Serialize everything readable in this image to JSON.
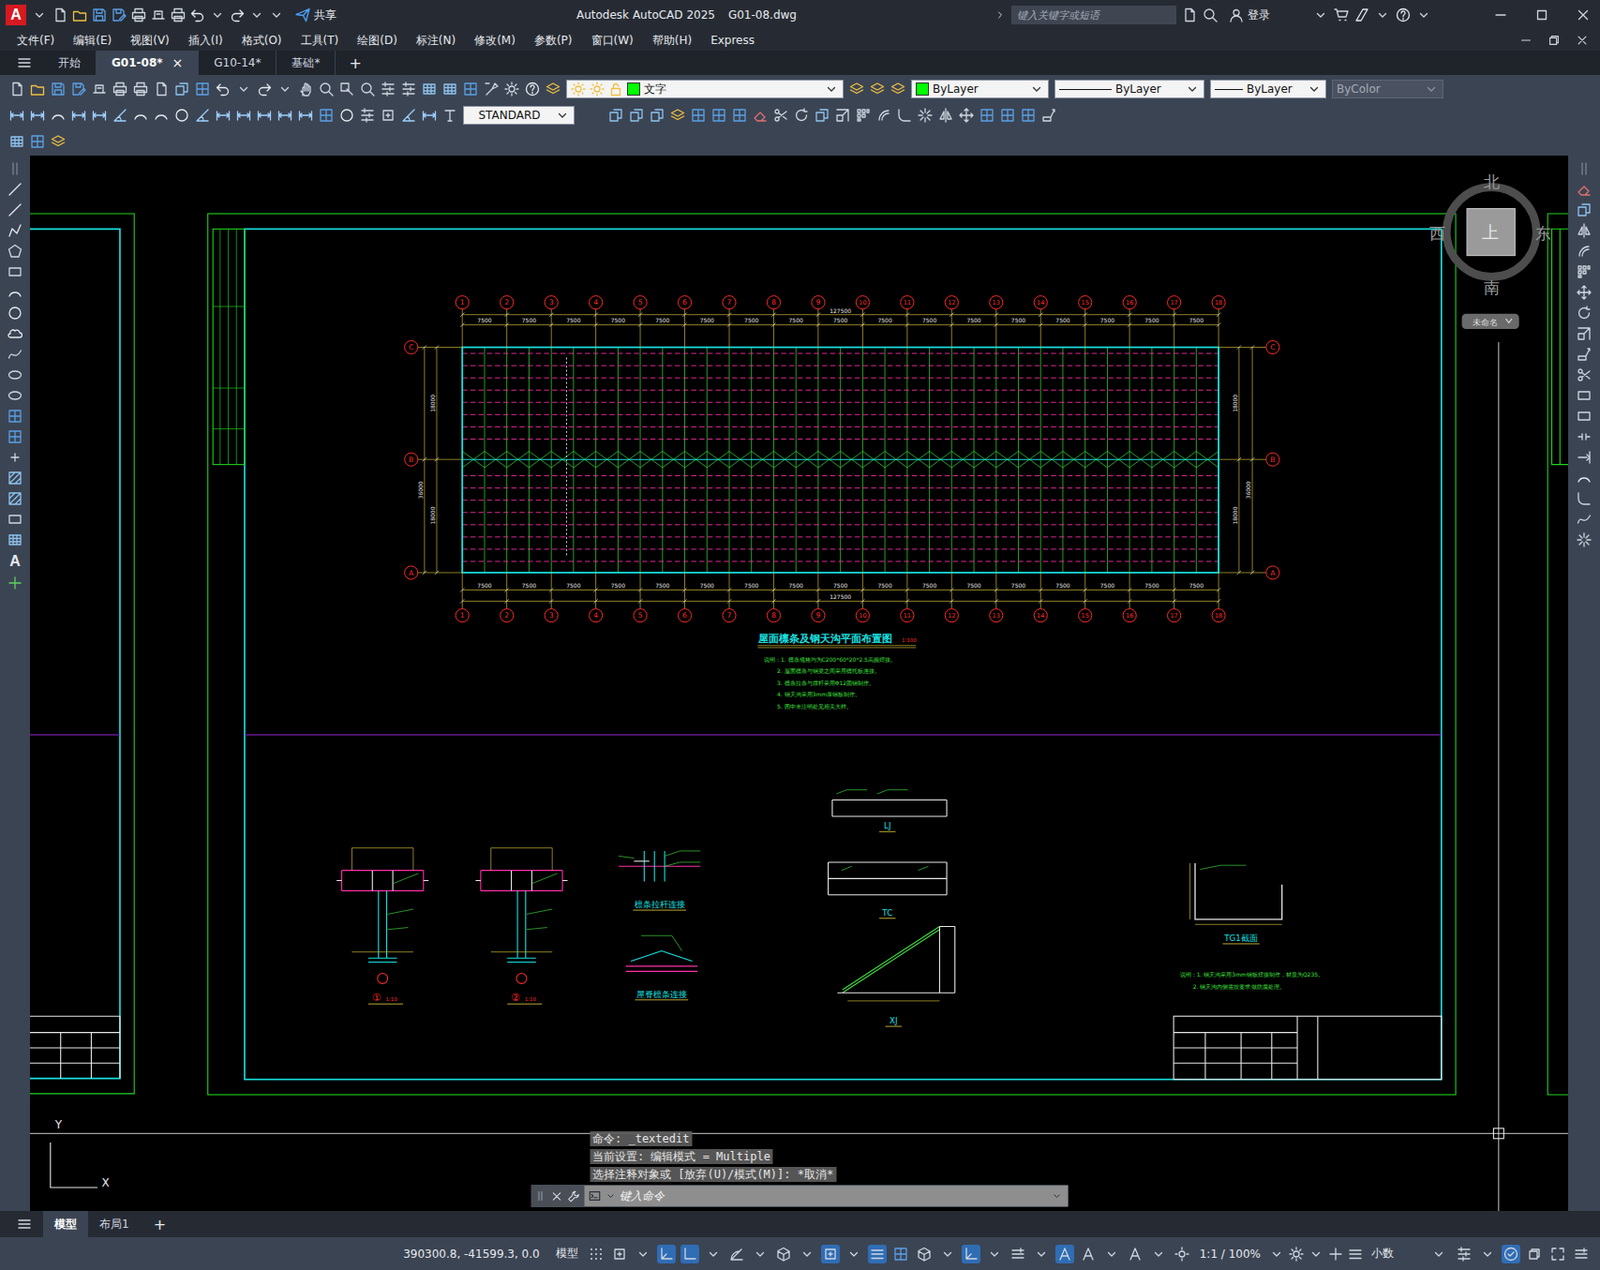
{
  "window": {
    "logo": "A",
    "share": "共享",
    "title": "Autodesk AutoCAD 2025",
    "file": "G01-08.dwg",
    "search_placeholder": "键入关键字或短语",
    "sign_in": "登录"
  },
  "menu": [
    "文件(F)",
    "编辑(E)",
    "视图(V)",
    "插入(I)",
    "格式(O)",
    "工具(T)",
    "绘图(D)",
    "标注(N)",
    "修改(M)",
    "参数(P)",
    "窗口(W)",
    "帮助(H)",
    "Express"
  ],
  "doc_tabs": {
    "items": [
      {
        "label": "开始",
        "selected": false
      },
      {
        "label": "G01-08*",
        "selected": true
      },
      {
        "label": "G10-14*",
        "selected": false
      },
      {
        "label": "基础*",
        "selected": false
      }
    ],
    "close": "×",
    "add": "+"
  },
  "toolbar": {
    "layer": {
      "value": "文字",
      "color": "#00ff00"
    },
    "color": {
      "value": "ByLayer",
      "color": "#00ff00"
    },
    "linetype": "ByLayer",
    "lineweight": "ByLayer",
    "plotstyle": {
      "value": "ByColor",
      "disabled": true
    },
    "text_style": "STANDARD"
  },
  "palettes": {
    "text_tool": "A"
  },
  "drawing": {
    "columns": [
      "1",
      "2",
      "3",
      "4",
      "5",
      "6",
      "7",
      "8",
      "9",
      "10",
      "11",
      "12",
      "13",
      "14",
      "15",
      "16",
      "17",
      "18"
    ],
    "rows": [
      "C",
      "B",
      "A"
    ],
    "bays_top": [
      "7500",
      "7500",
      "7500",
      "7500",
      "7500",
      "7500",
      "7500",
      "7500",
      "7500",
      "7500",
      "7500",
      "7500",
      "7500",
      "7500",
      "7500",
      "7500",
      "7500"
    ],
    "bays_bottom": [
      "7500",
      "7500",
      "7500",
      "7500",
      "7500",
      "7500",
      "7500",
      "7500",
      "7500",
      "7500",
      "7500",
      "7500",
      "7500",
      "7500",
      "7500",
      "7500",
      "7500"
    ],
    "total_top": "127500",
    "total_bottom": "127500",
    "side_dims_left": [
      "18000",
      "18000"
    ],
    "side_total_left": "36000",
    "side_dims_right": [
      "18000",
      "18000"
    ],
    "side_total_right": "36000",
    "title": "屋面檩条及钢天沟平面布置图",
    "scale": "1:100",
    "notes": [
      "说明：1. 檩条规格均为C200*60*20*2.5高频焊接。",
      "2. 屋面檩条与钢梁之间采用檩托板连接。",
      "3. 檩条拉条与撑杆采用Φ12圆钢制作。",
      "4. 钢天沟采用3mm厚钢板制作。",
      "5. 图中未注明处见相关大样。"
    ],
    "details": [
      {
        "kind": "column-cap",
        "label": "①",
        "scale": "1:10"
      },
      {
        "kind": "column-cap",
        "label": "②",
        "scale": "1:10"
      },
      {
        "kind": "tie-rod",
        "label": "檩条拉杆连接"
      },
      {
        "kind": "ridge",
        "label": "屋脊檩条连接"
      },
      {
        "kind": "lj",
        "label": "LJ"
      },
      {
        "kind": "tc",
        "label": "TC"
      },
      {
        "kind": "xj",
        "label": "XJ"
      },
      {
        "kind": "gutter",
        "label": "TG1截面"
      }
    ],
    "gutter_notes": [
      "说明：1. 钢天沟采用3mm钢板焊接制作，材质为Q235。",
      "2. 钢天沟内侧需按要求做防腐处理。"
    ]
  },
  "viewcube": {
    "north": "北",
    "south": "南",
    "east": "东",
    "west": "西",
    "face": "上",
    "ucs_menu": "未命名"
  },
  "ucs_icon": {
    "x": "X",
    "y": "Y"
  },
  "command": {
    "history": [
      "命令: _textedit",
      "当前设置: 编辑模式 = Multiple",
      "选择注释对象或 [放弃(U)/模式(M)]: *取消*"
    ],
    "placeholder": "键入命令"
  },
  "layout_tabs": {
    "items": [
      {
        "label": "模型",
        "selected": true
      },
      {
        "label": "布局1",
        "selected": false
      }
    ],
    "add": "+"
  },
  "status_bar": {
    "coordinates": "390300.8, -41599.3, 0.0",
    "space": "模型",
    "toggles": [
      {
        "on": false
      },
      {
        "on": false
      },
      {
        "on": false
      },
      {
        "on": true
      },
      {
        "on": true
      },
      {
        "on": false
      },
      {
        "on": false
      },
      {
        "on": false
      },
      {
        "on": false
      },
      {
        "on": false
      },
      {
        "on": true
      },
      {
        "on": false
      },
      {
        "on": true
      },
      {
        "on": false
      },
      {
        "on": false
      },
      {
        "on": false
      },
      {
        "on": true
      },
      {
        "on": false
      },
      {
        "on": false
      },
      {
        "on": false
      },
      {
        "on": true
      },
      {
        "on": false
      },
      {
        "on": false
      },
      {
        "on": false
      },
      {
        "on": false
      },
      {
        "on": false
      }
    ],
    "scale": "1:1 / 100%",
    "units": "小数",
    "tail_toggles": [
      {
        "on": false
      },
      {
        "on": false
      },
      {
        "on": true
      },
      {
        "on": false
      },
      {
        "on": false
      },
      {
        "on": false
      }
    ]
  }
}
